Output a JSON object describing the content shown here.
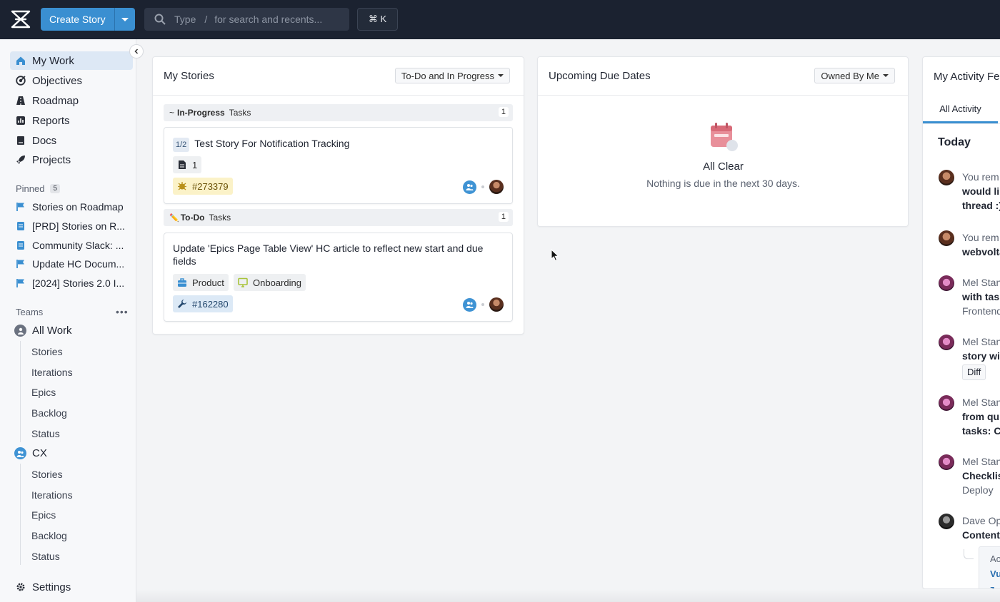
{
  "topbar": {
    "create_label": "Create Story",
    "search_placeholder_prefix": "Type",
    "search_slash": "/",
    "search_placeholder_suffix": "for search and recents...",
    "shortcut": "⌘ K"
  },
  "sidebar": {
    "nav": [
      "My Work",
      "Objectives",
      "Roadmap",
      "Reports",
      "Docs",
      "Projects"
    ],
    "pinned_label": "Pinned",
    "pinned_count": "5",
    "pinned": [
      "Stories on Roadmap",
      "[PRD] Stories on R...",
      "Community Slack: ...",
      "Update HC Docum...",
      "[2024] Stories 2.0 I..."
    ],
    "teams_label": "Teams",
    "teams_more": "•••",
    "teams": [
      {
        "name": "All Work",
        "items": [
          "Stories",
          "Iterations",
          "Epics",
          "Backlog",
          "Status"
        ]
      },
      {
        "name": "CX",
        "items": [
          "Stories",
          "Iterations",
          "Epics",
          "Backlog",
          "Status"
        ]
      }
    ],
    "settings": "Settings"
  },
  "my_stories": {
    "title": "My Stories",
    "filter": "To-Do and In Progress",
    "groups": [
      {
        "prefix": "~",
        "state": "In-Progress",
        "label": "Tasks",
        "count": "1",
        "story": {
          "progress": "1/2",
          "title": "Test Story For Notification Tracking",
          "doc_count": "1",
          "id": "#273379"
        }
      },
      {
        "prefix": "✏️",
        "state": "To-Do",
        "label": "Tasks",
        "count": "1",
        "story": {
          "title": "Update 'Epics Page Table View' HC article to reflect new start and due fields",
          "labels": [
            "Product",
            "Onboarding"
          ],
          "id": "#162280"
        }
      }
    ]
  },
  "due_dates": {
    "title": "Upcoming Due Dates",
    "filter": "Owned By Me",
    "empty_title": "All Clear",
    "empty_sub": "Nothing is due in the next 30 days."
  },
  "activity": {
    "title": "My Activity Fe",
    "tab": "All Activity",
    "today": "Today",
    "items": [
      {
        "lines": [
          "You rem",
          "would lik",
          "thread :)"
        ]
      },
      {
        "lines": [
          "You rem",
          "webvolta"
        ]
      },
      {
        "lines": [
          "Mel Stan",
          "with task",
          "Frontend"
        ]
      },
      {
        "lines": [
          "Mel Stan",
          "story wit"
        ],
        "chip": "Diff"
      },
      {
        "lines": [
          "Mel Stan",
          "from qui",
          "tasks: Ch"
        ]
      },
      {
        "lines": [
          "Mel Stan",
          "Checklis",
          "Deploy"
        ]
      },
      {
        "lines": [
          "Dave Op",
          "Content-"
        ]
      }
    ],
    "preview_lines": [
      "Ac",
      "Vu",
      "z"
    ]
  },
  "colors": {
    "accent": "#3a8fd1",
    "topbar": "#1b2230",
    "id_yellow": "#fbf2c8",
    "id_blue": "#dce9f6"
  }
}
